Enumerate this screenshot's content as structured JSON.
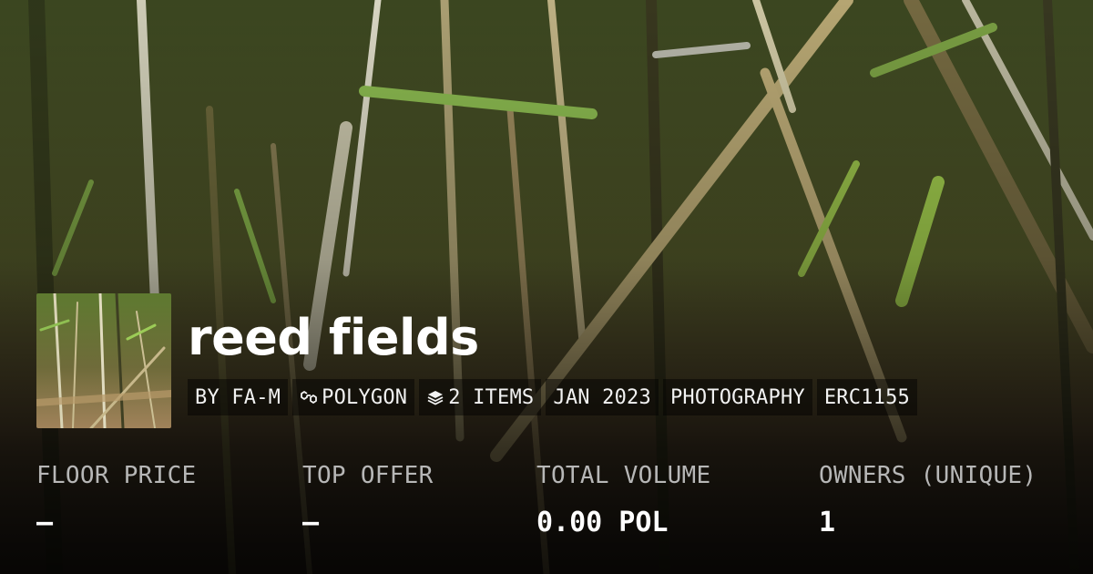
{
  "collection": {
    "title": "reed fields",
    "tags": [
      {
        "icon": "",
        "label": "BY FA-M"
      },
      {
        "icon": "polygon-chain-icon",
        "label": "POLYGON"
      },
      {
        "icon": "layers-stack-icon",
        "label": "2 ITEMS"
      },
      {
        "icon": "",
        "label": "JAN 2023"
      },
      {
        "icon": "",
        "label": "PHOTOGRAPHY"
      },
      {
        "icon": "",
        "label": "ERC1155"
      }
    ]
  },
  "stats": [
    {
      "label": "FLOOR PRICE",
      "value": "–"
    },
    {
      "label": "TOP OFFER",
      "value": "–"
    },
    {
      "label": "TOTAL VOLUME",
      "value": "0.00 POL"
    },
    {
      "label": "OWNERS (UNIQUE)",
      "value": "1"
    }
  ],
  "colors": {
    "text_primary": "#ffffff",
    "text_muted": "#b7b7b7",
    "tag_background": "rgba(0,0,0,0.45)"
  }
}
